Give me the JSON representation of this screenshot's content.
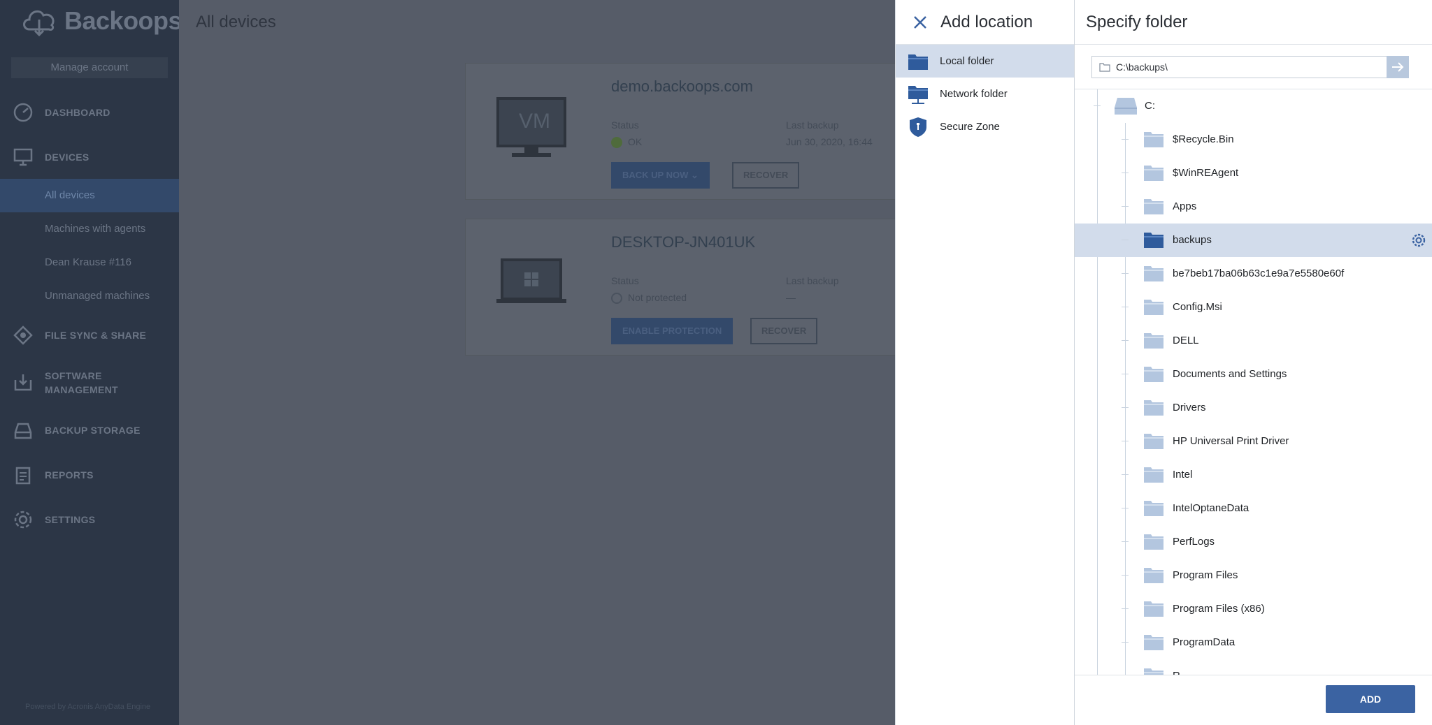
{
  "sidebar": {
    "brand": "Backoops",
    "manage_account": "Manage account",
    "nav": {
      "dashboard": "DASHBOARD",
      "devices": "DEVICES",
      "file_sync": "FILE SYNC & SHARE",
      "software_line1": "SOFTWARE",
      "software_line2": "MANAGEMENT",
      "backup_storage": "BACKUP STORAGE",
      "reports": "REPORTS",
      "settings": "SETTINGS"
    },
    "device_items": [
      "All devices",
      "Machines with agents",
      "Dean Krause #116",
      "Unmanaged machines"
    ],
    "powered_by": "Powered by Acronis AnyData Engine"
  },
  "main": {
    "title": "All devices",
    "devices": [
      {
        "name": "demo.backoops.com",
        "monitor_label": "VM",
        "status_label": "Status",
        "status_value": "OK",
        "last_backup_label": "Last backup",
        "last_backup_value": "Jun 30, 2020, 16:44",
        "primary_action": "BACK UP NOW",
        "secondary_action": "RECOVER"
      },
      {
        "name": "DESKTOP-JN401UK",
        "status_label": "Status",
        "status_value": "Not protected",
        "last_backup_label": "Last backup",
        "last_backup_value": "—",
        "primary_action": "ENABLE PROTECTION",
        "secondary_action": "RECOVER"
      }
    ]
  },
  "add_location": {
    "title": "Add location",
    "items": [
      {
        "label": "Local folder",
        "icon": "folder-icon"
      },
      {
        "label": "Network folder",
        "icon": "network-folder-icon"
      },
      {
        "label": "Secure Zone",
        "icon": "shield-icon"
      }
    ],
    "selected": "Local folder"
  },
  "specify_folder": {
    "title": "Specify folder",
    "path_value": "C:\\backups\\",
    "drive": "C:",
    "folders": [
      "$Recycle.Bin",
      "$WinREAgent",
      "Apps",
      "backups",
      "be7beb17ba06b63c1e9a7e5580e60f",
      "Config.Msi",
      "DELL",
      "Documents and Settings",
      "Drivers",
      "HP Universal Print Driver",
      "Intel",
      "IntelOptaneData",
      "PerfLogs",
      "Program Files",
      "Program Files (x86)",
      "ProgramData",
      "R..."
    ],
    "selected_folder": "backups",
    "add_button": "ADD"
  },
  "colors": {
    "accent": "#3b63a2",
    "selected_bg": "#d2dceb",
    "folder_light": "#b3c6df",
    "folder_dark": "#2f5b9c"
  }
}
